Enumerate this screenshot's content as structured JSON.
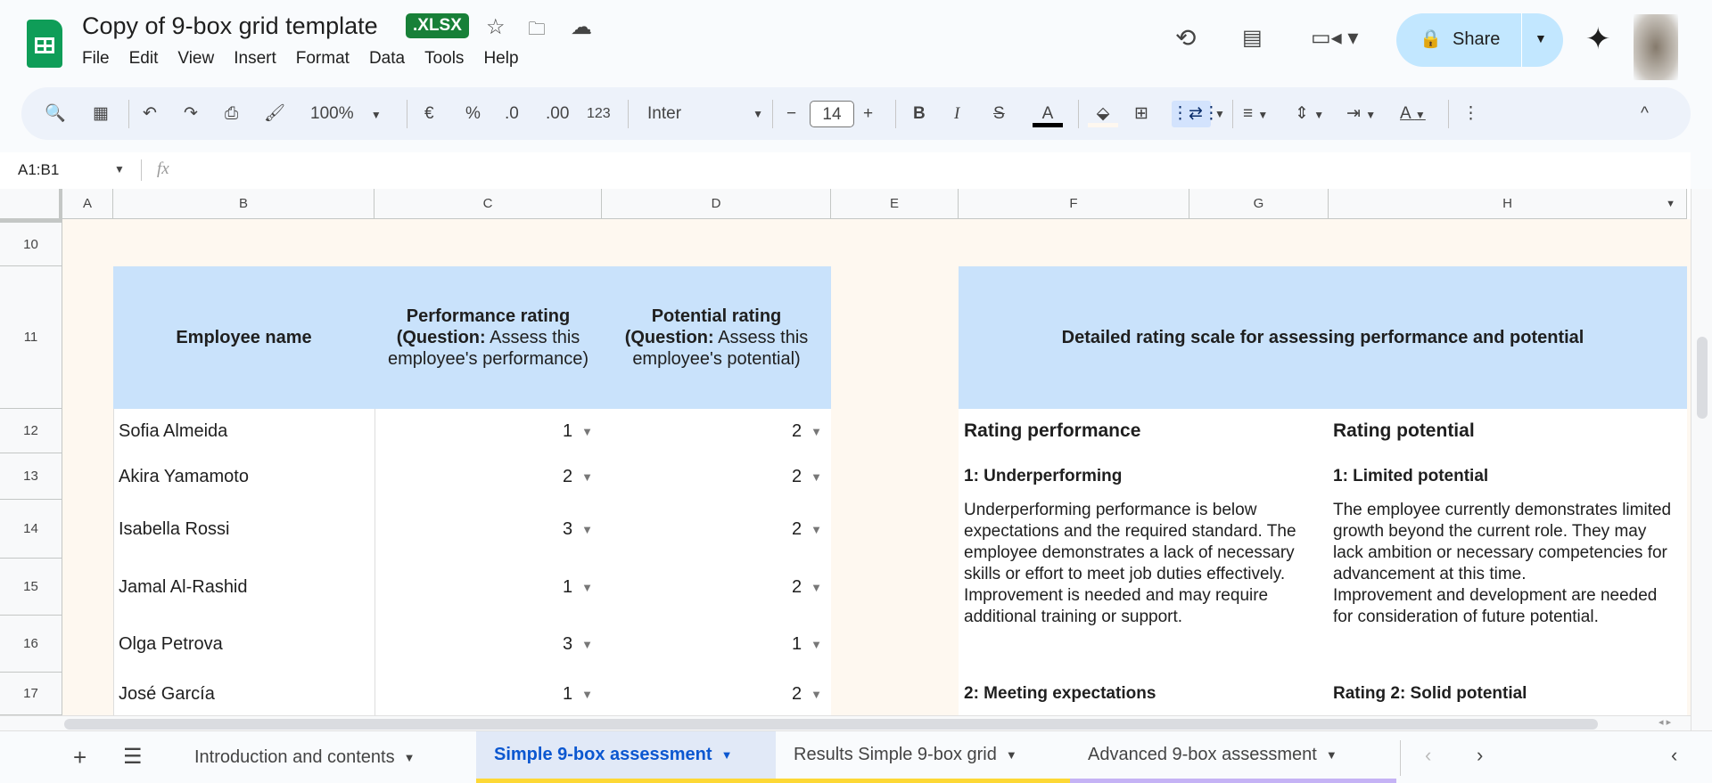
{
  "app": {
    "title": "Copy of 9-box grid template",
    "badge": ".XLSX",
    "menu": [
      "File",
      "Edit",
      "View",
      "Insert",
      "Format",
      "Data",
      "Tools",
      "Help"
    ],
    "share_label": "Share"
  },
  "toolbar": {
    "zoom": "100%",
    "currency": "€",
    "percent": "%",
    "dec_decrease": ".0",
    "dec_increase": ".00",
    "number_format": "123",
    "font": "Inter",
    "font_size": "14"
  },
  "formula_bar": {
    "cell_ref": "A1:B1",
    "fx": "fx",
    "value": ""
  },
  "columns": [
    "A",
    "B",
    "C",
    "D",
    "E",
    "F",
    "G",
    "H"
  ],
  "rows": [
    "10",
    "11",
    "12",
    "13",
    "14",
    "15",
    "16",
    "17"
  ],
  "table": {
    "headers": {
      "name": "Employee name",
      "perf_title": "Performance rating",
      "perf_q_bold": "(Question:",
      "perf_q": " Assess this employee's performance)",
      "pot_title": "Potential rating",
      "pot_q_bold": "(Question:",
      "pot_q": " Assess this employee's potential)"
    },
    "employees": [
      {
        "name": "Sofia Almeida",
        "performance": "1",
        "potential": "2"
      },
      {
        "name": "Akira Yamamoto",
        "performance": "2",
        "potential": "2"
      },
      {
        "name": "Isabella Rossi",
        "performance": "3",
        "potential": "2"
      },
      {
        "name": "Jamal Al-Rashid",
        "performance": "1",
        "potential": "2"
      },
      {
        "name": "Olga Petrova",
        "performance": "3",
        "potential": "1"
      },
      {
        "name": "José García",
        "performance": "1",
        "potential": "2"
      }
    ]
  },
  "scale": {
    "title": "Detailed rating scale for assessing performance and potential",
    "perf_heading": "Rating performance",
    "pot_heading": "Rating potential",
    "perf_1_title": "1: Underperforming",
    "perf_1_text": "Underperforming performance is below expectations and the required standard. The employee demonstrates a lack of necessary skills or effort to meet job duties effectively.",
    "perf_1_text2": "Improvement is needed and may require additional training or support.",
    "pot_1_title": "1: Limited potential",
    "pot_1_text": "The employee currently demonstrates limited growth beyond the current role. They may lack ambition or necessary competencies for advancement at this time.",
    "pot_1_text2": "Improvement and development are needed for consideration of future potential.",
    "perf_2_title": "2: Meeting expectations",
    "pot_2_title": "Rating 2: Solid potential"
  },
  "sheets": [
    {
      "label": "Introduction and contents",
      "active": false
    },
    {
      "label": "Simple 9-box assessment",
      "active": true
    },
    {
      "label": "Results Simple 9-box grid",
      "active": false
    },
    {
      "label": "Advanced 9-box assessment",
      "active": false
    }
  ],
  "colors": {
    "header_blue": "#c9e2fb",
    "background_cream": "#fef8f0",
    "active_tab": "#0b57d0",
    "tab_yellow": "#fdd835",
    "tab_purple": "#c5b3f5",
    "share_bg": "#c2e7ff"
  }
}
